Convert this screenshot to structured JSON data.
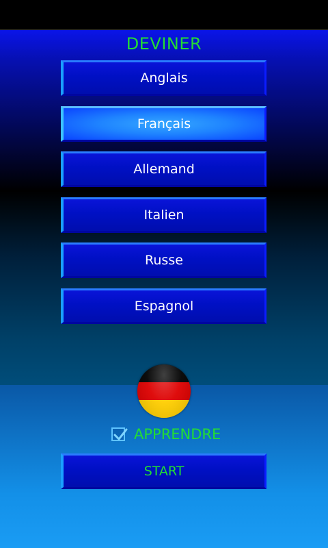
{
  "title": "DEVINER",
  "languages": [
    {
      "label": "Anglais",
      "selected": false
    },
    {
      "label": "Français",
      "selected": true
    },
    {
      "label": "Allemand",
      "selected": false
    },
    {
      "label": "Italien",
      "selected": false
    },
    {
      "label": "Russe",
      "selected": false
    },
    {
      "label": "Espagnol",
      "selected": false
    }
  ],
  "flag": {
    "icon": "germany-flag-icon",
    "colors": [
      "#000000",
      "#dd0000",
      "#ffce00"
    ]
  },
  "learn": {
    "label": "APPRENDRE",
    "checked": true
  },
  "start_label": "START",
  "colors": {
    "title_green": "#22dd33",
    "button_blue": "#0010c4",
    "button_selected": "#1f84ff"
  }
}
